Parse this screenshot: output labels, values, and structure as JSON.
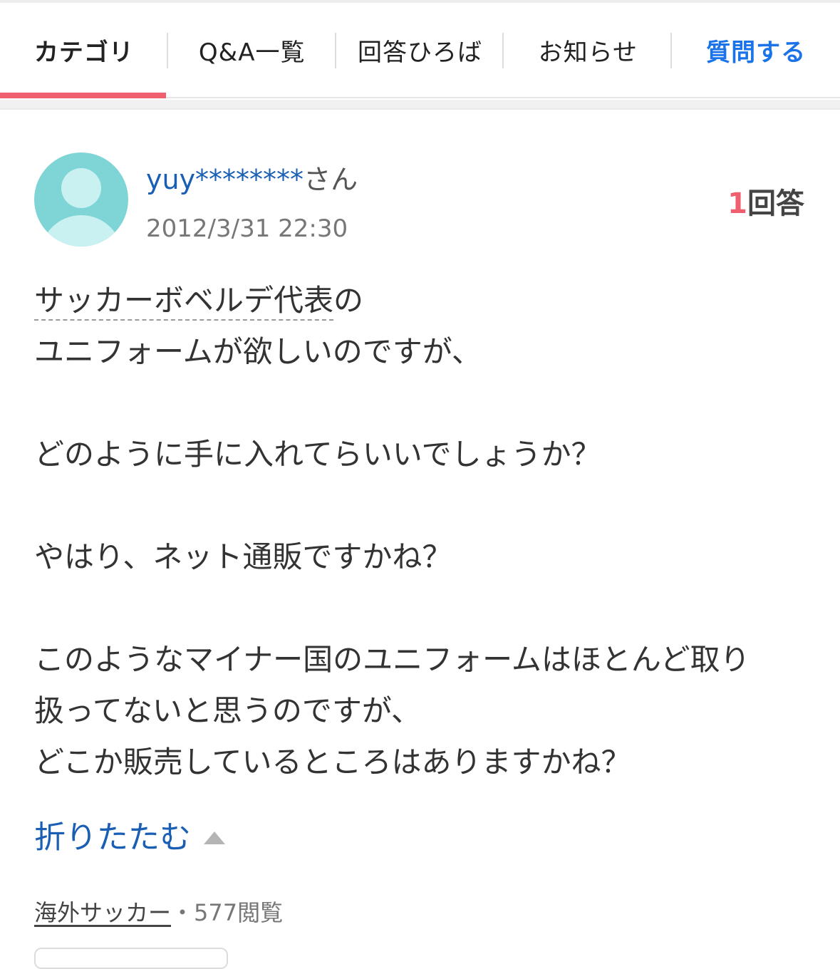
{
  "tabs": [
    {
      "label": "カテゴリ",
      "active": true
    },
    {
      "label": "Q&A一覧",
      "active": false
    },
    {
      "label": "回答ひろば",
      "active": false
    },
    {
      "label": "お知らせ",
      "active": false
    },
    {
      "label": "質問する",
      "active": false
    }
  ],
  "question": {
    "user_name": "yuy********",
    "user_suffix": "さん",
    "date": "2012/3/31 22:30",
    "answer_count": "1",
    "answer_label": "回答",
    "keyword_link": "サッカーボベルデ代表",
    "line1_tail": "の",
    "line2": "ユニフォームが欲しいのですが、",
    "line3": "どのように手に入れてらいいでしょうか？",
    "line4": "やはり、ネット通販ですかね？",
    "line5": "このようなマイナー国のユニフォームはほとんど取り",
    "line6": "扱ってないと思うのですが、",
    "line7": "どこか販売しているところはありますかね？"
  },
  "collapse_label": "折りたたむ",
  "meta": {
    "category": "海外サッカー",
    "separator": "・",
    "views": "577閲覧"
  },
  "colors": {
    "accent_red": "#ef5f6f",
    "link_blue": "#1a5fb4",
    "avatar_teal": "#7fd5d6"
  }
}
